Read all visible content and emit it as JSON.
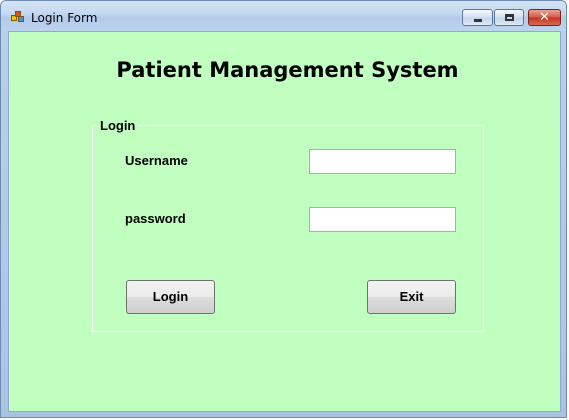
{
  "window": {
    "title": "Login Form",
    "controls": {
      "minimize_icon": "minimize-icon",
      "maximize_icon": "maximize-icon",
      "close_glyph": "✕"
    }
  },
  "main": {
    "heading": "Patient Management System",
    "group_label": "Login",
    "username_label": "Username",
    "username_value": "",
    "password_label": "password",
    "password_value": "",
    "login_button": "Login",
    "exit_button": "Exit"
  },
  "colors": {
    "form_background": "#c0ffc0",
    "close_button": "#c2341f"
  }
}
